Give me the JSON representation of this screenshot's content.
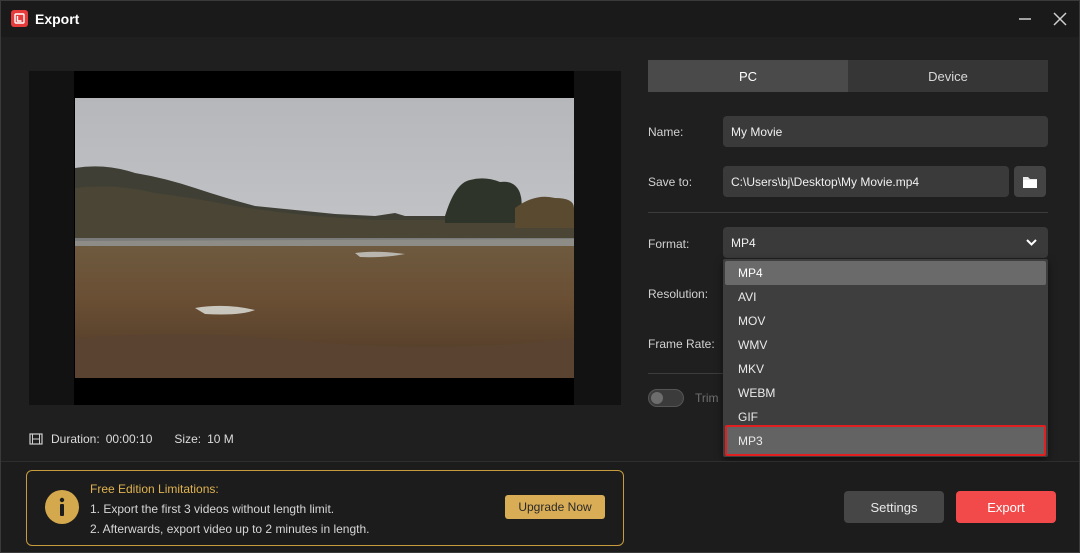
{
  "window": {
    "title": "Export"
  },
  "tabs": [
    {
      "label": "PC"
    },
    {
      "label": "Device"
    }
  ],
  "form": {
    "name_label": "Name:",
    "name_value": "My Movie",
    "save_label": "Save to:",
    "save_value": "C:\\Users\\bj\\Desktop\\My Movie.mp4",
    "format_label": "Format:",
    "format_value": "MP4",
    "resolution_label": "Resolution:",
    "framerate_label": "Frame Rate:",
    "trim_label": "Trim"
  },
  "format_dropdown": {
    "options": [
      "MP4",
      "AVI",
      "MOV",
      "WMV",
      "MKV",
      "WEBM",
      "GIF",
      "MP3"
    ],
    "selected": "MP4",
    "highlighted": "MP3"
  },
  "preview": {
    "duration_label": "Duration:",
    "duration_value": "00:00:10",
    "size_label": "Size:",
    "size_value": "10 M"
  },
  "notice": {
    "title": "Free Edition Limitations:",
    "line1": "1. Export the first 3 videos without length limit.",
    "line2": "2. Afterwards, export video up to 2 minutes in length.",
    "upgrade_label": "Upgrade Now"
  },
  "actions": {
    "settings_label": "Settings",
    "export_label": "Export"
  },
  "colors": {
    "accent": "#f24a4a",
    "notice": "#d9ad55",
    "highlight_border": "#e02020"
  }
}
